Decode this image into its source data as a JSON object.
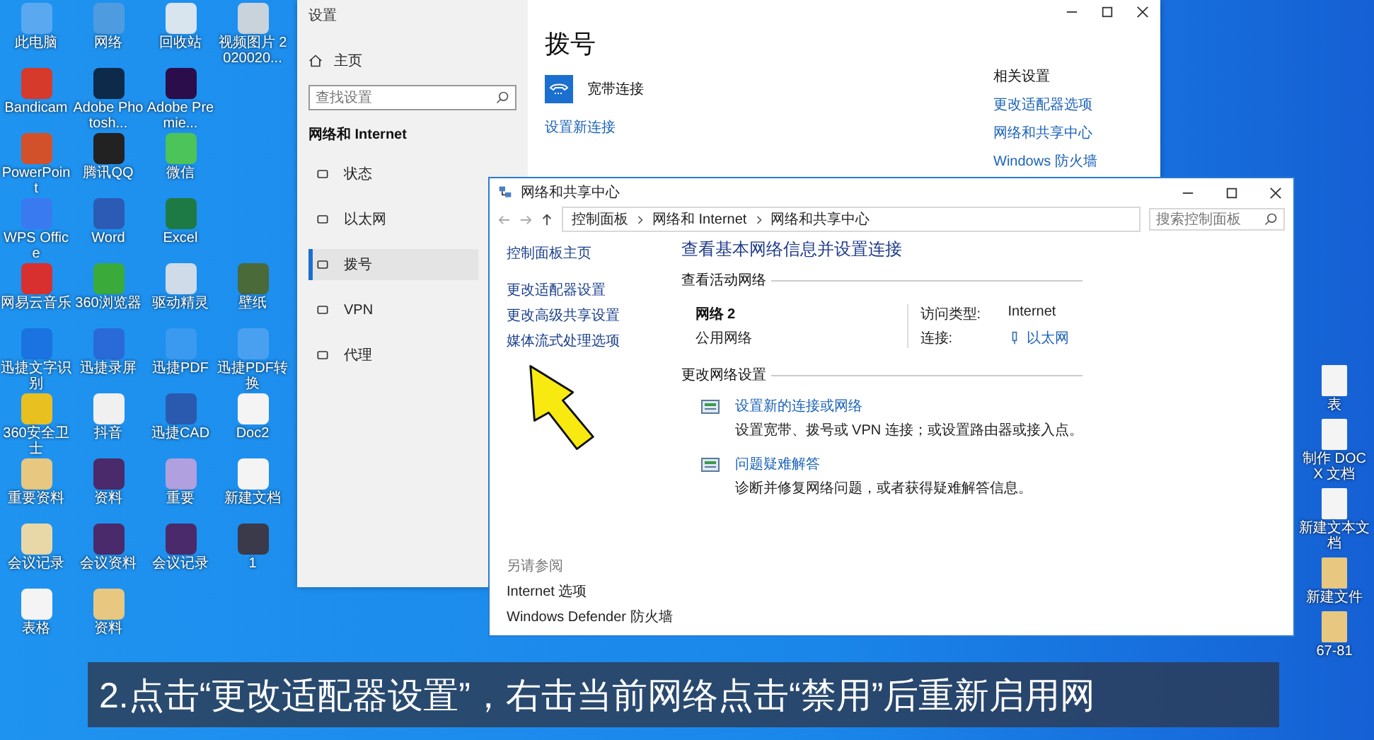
{
  "desktop": {
    "left_rows": [
      [
        {
          "label": "此电脑",
          "color": "#5aa9f0"
        },
        {
          "label": "网络",
          "color": "#4f9be0"
        },
        {
          "label": "回收站",
          "color": "#d8e4ee"
        },
        {
          "label": "视频图片 2020020...",
          "color": "#c9d3dc"
        }
      ],
      [
        {
          "label": "Bandicam",
          "color": "#d63a2a"
        },
        {
          "label": "Adobe Photosh...",
          "color": "#0d2a4a"
        },
        {
          "label": "Adobe Premie...",
          "color": "#2a0d4a"
        }
      ],
      [
        {
          "label": "PowerPoint",
          "color": "#d2512b"
        },
        {
          "label": "腾讯QQ",
          "color": "#222222"
        },
        {
          "label": "微信",
          "color": "#4cc45a"
        }
      ],
      [
        {
          "label": "WPS Office",
          "color": "#3a7af0"
        },
        {
          "label": "Word",
          "color": "#2b5bb5"
        },
        {
          "label": "Excel",
          "color": "#1e7a44"
        }
      ],
      [
        {
          "label": "网易云音乐",
          "color": "#d8302f"
        },
        {
          "label": "360浏览器",
          "color": "#3aaa3a"
        },
        {
          "label": "驱动精灵",
          "color": "#cfdbe8"
        },
        {
          "label": "壁纸",
          "color": "#4a6a3a"
        }
      ],
      [
        {
          "label": "迅捷文字识别",
          "color": "#1a73e0"
        },
        {
          "label": "迅捷录屏",
          "color": "#2a6ad8"
        },
        {
          "label": "迅捷PDF",
          "color": "#3a9af0"
        },
        {
          "label": "迅捷PDF转换",
          "color": "#4aa0f0"
        }
      ],
      [
        {
          "label": "360安全卫士",
          "color": "#e8c020"
        },
        {
          "label": "抖音",
          "color": "#f0f0f0"
        },
        {
          "label": "迅捷CAD",
          "color": "#2a5ab0"
        },
        {
          "label": "Doc2",
          "color": "#f4f4f4"
        }
      ],
      [
        {
          "label": "重要资料",
          "color": "#e8c880"
        },
        {
          "label": "资料",
          "color": "#4a2a6a"
        },
        {
          "label": "重要",
          "color": "#b0a0e0"
        },
        {
          "label": "新建文档",
          "color": "#f4f4f4"
        }
      ],
      [
        {
          "label": "会议记录",
          "color": "#e8d8a8"
        },
        {
          "label": "会议资料",
          "color": "#4a2a6a"
        },
        {
          "label": "会议记录",
          "color": "#4a2a6a"
        },
        {
          "label": "1",
          "color": "#3a3a4a"
        }
      ],
      [
        {
          "label": "表格",
          "color": "#f4f4f4"
        },
        {
          "label": "资料",
          "color": "#e8c880"
        }
      ]
    ],
    "right_icons": [
      {
        "label": "表",
        "color": "#f4f4f4"
      },
      {
        "label": "制作 DOCX 文档",
        "color": "#f4f4f4"
      },
      {
        "label": "新建文本文档",
        "color": "#f4f4f4"
      },
      {
        "label": "新建文件",
        "color": "#e8c880"
      },
      {
        "label": "67-81",
        "color": "#e8c880"
      }
    ]
  },
  "settings_window": {
    "title": "设置",
    "home": "主页",
    "search": {
      "placeholder": "查找设置"
    },
    "section": "网络和 Internet",
    "nav": [
      {
        "label": "状态",
        "selected": false
      },
      {
        "label": "以太网",
        "selected": false
      },
      {
        "label": "拨号",
        "selected": true
      },
      {
        "label": "VPN",
        "selected": false
      },
      {
        "label": "代理",
        "selected": false
      }
    ],
    "heading": "拨号",
    "connection": "宽带连接",
    "new_connection_link": "设置新连接",
    "related": {
      "title": "相关设置",
      "links": [
        "更改适配器选项",
        "网络和共享中心",
        "Windows 防火墙"
      ]
    }
  },
  "network_window": {
    "title": "网络和共享中心",
    "breadcrumb": [
      "控制面板",
      "网络和 Internet",
      "网络和共享中心"
    ],
    "search": {
      "placeholder": "搜索控制面板"
    },
    "sidebar_links": [
      "控制面板主页",
      "更改适配器设置",
      "更改高级共享设置",
      "媒体流式处理选项"
    ],
    "see_also": {
      "title": "另请参阅",
      "links": [
        "Internet 选项",
        "Windows Defender 防火墙"
      ]
    },
    "heading": "查看基本网络信息并设置连接",
    "active_title": "查看活动网络",
    "network_name": "网络 2",
    "network_type": "公用网络",
    "access_label": "访问类型:",
    "access_value": "Internet",
    "connection_label": "连接:",
    "connection_value": "以太网",
    "change_title": "更改网络设置",
    "tasks": [
      {
        "link": "设置新的连接或网络",
        "description": "设置宽带、拨号或 VPN 连接；或设置路由器或接入点。"
      },
      {
        "link": "问题疑难解答",
        "description": "诊断并修复网络问题，或者获得疑难解答信息。"
      }
    ]
  },
  "subtitle": "2.点击“更改适配器设置”，右击当前网络点击“禁用”后重新启用网"
}
